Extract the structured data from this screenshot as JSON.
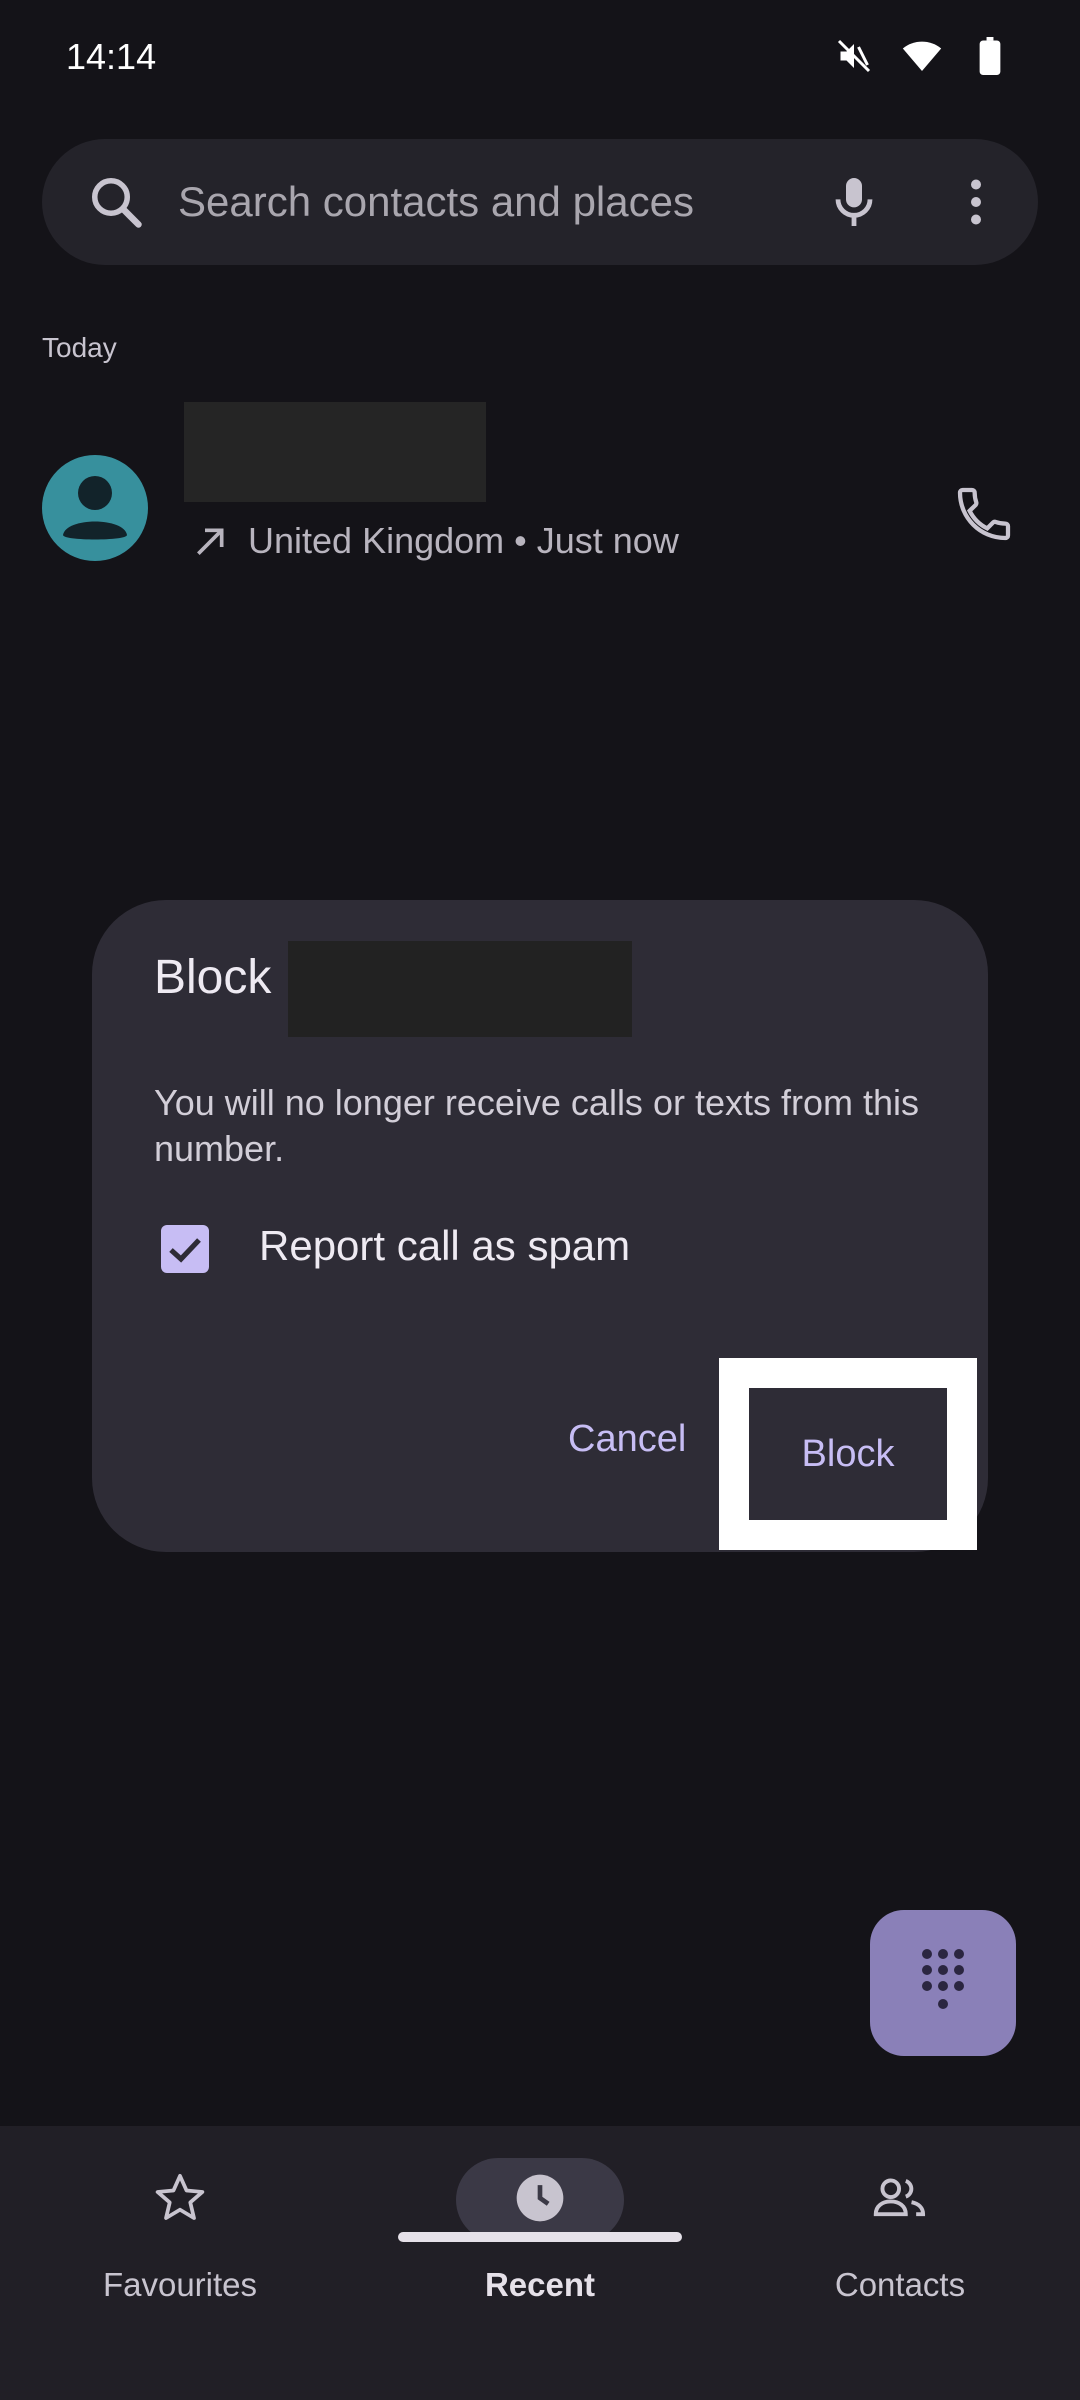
{
  "status_bar": {
    "time": "14:14"
  },
  "search": {
    "placeholder": "Search contacts and places"
  },
  "recent": {
    "section_label": "Today",
    "call": {
      "meta": "United Kingdom • Just now"
    }
  },
  "dialog": {
    "title_prefix": "Block",
    "message": "You will no longer receive calls or texts from this number.",
    "checkbox_label": "Report call as spam",
    "checkbox_checked": true,
    "cancel_label": "Cancel",
    "confirm_label": "Block"
  },
  "nav": {
    "items": [
      {
        "label": "Favourites",
        "icon": "star-icon"
      },
      {
        "label": "Recent",
        "icon": "clock-icon",
        "active": true
      },
      {
        "label": "Contacts",
        "icon": "contacts-icon"
      }
    ]
  },
  "colors": {
    "accent": "#c7bdf4",
    "background": "#141318",
    "dialog": "#2e2c36",
    "avatar": "#37909d",
    "fab": "#8a80b8"
  }
}
